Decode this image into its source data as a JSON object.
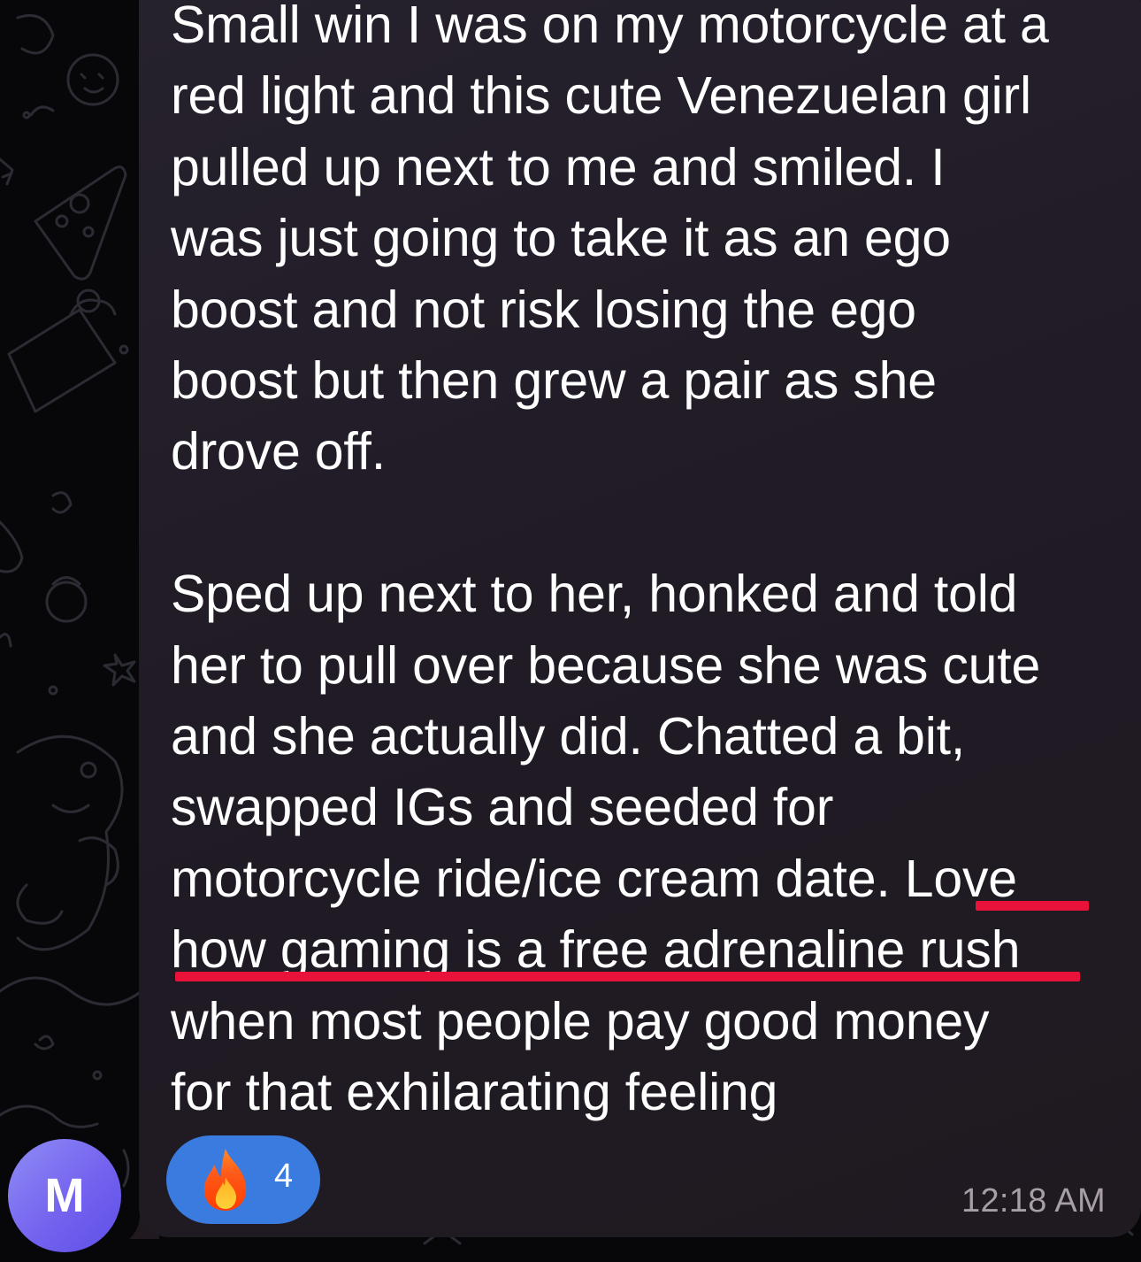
{
  "message": {
    "paragraphs": [
      "Small win I was on my motorcycle at a\nred light and this cute Venezuelan girl\npulled up next to me and smiled. I\nwas just going to take it as an ego\nboost and not risk losing the ego\nboost but then grew a pair as she\ndrove off.",
      "Sped up next to her, honked and told\nher to pull over because she was cute\nand she actually did. Chatted a bit,\nswapped IGs and seeded for\nmotorcycle ride/ice cream date. Love\nhow gaming is a free adrenaline rush\nwhen most people pay good money\nfor that exhilarating feeling"
    ],
    "time": "12:18 AM"
  },
  "reaction": {
    "emoji": "fire-emoji",
    "count": "4"
  },
  "sender": {
    "avatar_initial": "M",
    "avatar_color": "#7463ef"
  },
  "colors": {
    "bubble": "#231d28",
    "background": "#07070a",
    "reaction_pill": "#3a7be0",
    "annotation_underline": "#e8123a",
    "timestamp": "#a79ea8"
  }
}
